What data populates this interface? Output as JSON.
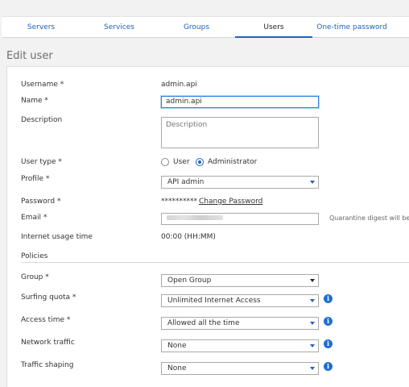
{
  "tabs": [
    "Servers",
    "Services",
    "Groups",
    "Users",
    "One-time password"
  ],
  "active_tab": "Users",
  "page_title": "Edit user",
  "form": {
    "username_label": "Username *",
    "username_value": "admin.api",
    "name_label": "Name *",
    "name_value": "admin.api",
    "description_label": "Description",
    "description_placeholder": "Description",
    "user_type_label": "User type *",
    "user_type_options": [
      "User",
      "Administrator"
    ],
    "user_type_selected": "Administrator",
    "profile_label": "Profile *",
    "profile_value": "API admin",
    "password_label": "Password *",
    "password_mask": "**********",
    "change_password_link": "Change Password",
    "email_label": "Email *",
    "email_side_note": "Quarantine digest will be se",
    "internet_usage_label": "Internet usage time",
    "internet_usage_value": "00:00 (HH:MM)"
  },
  "policies": {
    "section_label": "Policies",
    "group_label": "Group *",
    "group_value": "Open Group",
    "surfing_quota_label": "Surfing quota *",
    "surfing_quota_value": "Unlimited Internet Access",
    "access_time_label": "Access time *",
    "access_time_value": "Allowed all the time",
    "network_traffic_label": "Network traffic",
    "network_traffic_value": "None",
    "traffic_shaping_label": "Traffic shaping",
    "traffic_shaping_value": "None"
  },
  "icons": {
    "info": "info-icon",
    "dropdown": "chevron-down-icon"
  },
  "colors": {
    "accent": "#1f63b8",
    "info_badge": "#1f6fd0",
    "background": "#f2f2f2"
  }
}
